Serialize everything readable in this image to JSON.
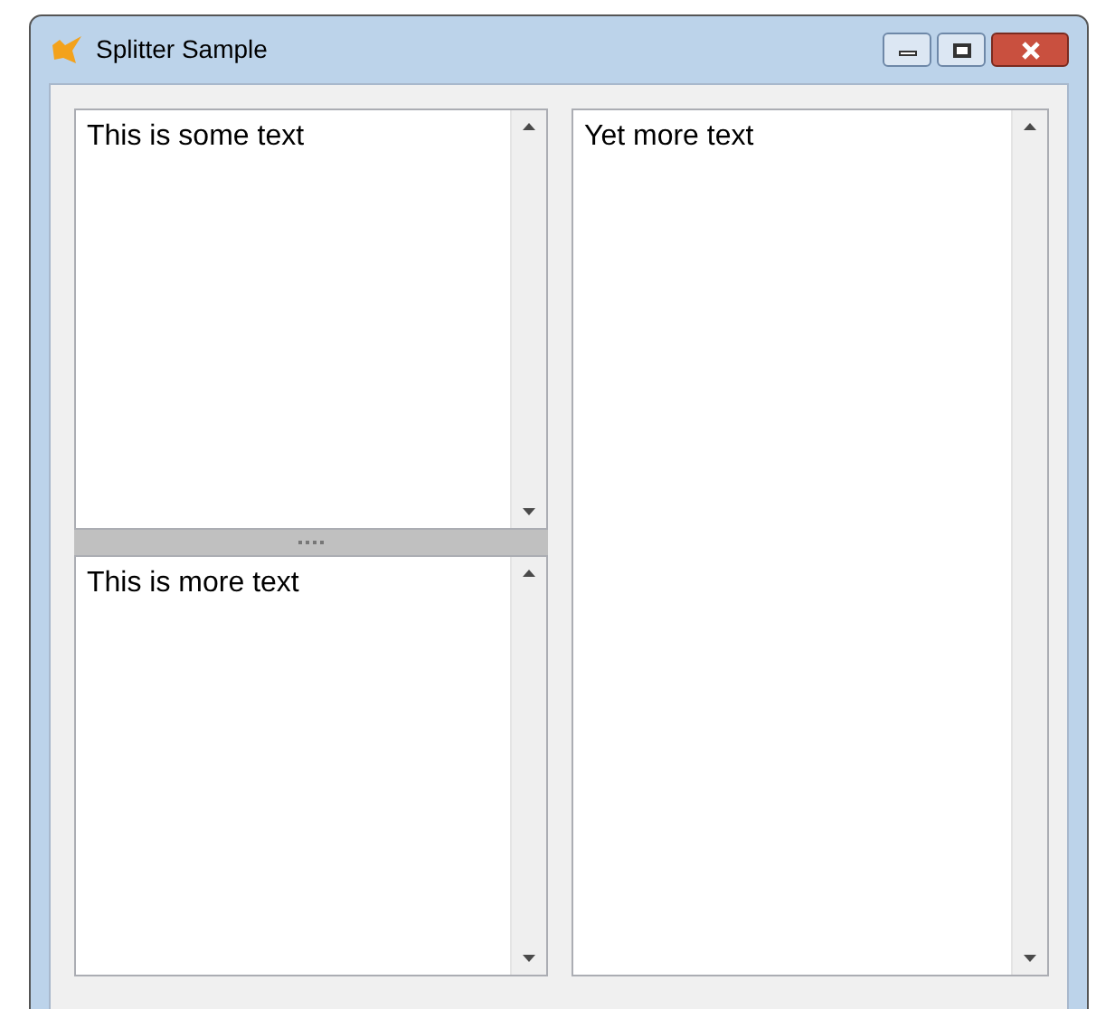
{
  "window": {
    "title": "Splitter Sample"
  },
  "left_panes": [
    {
      "text": "This is some text"
    },
    {
      "text": "This is more text"
    }
  ],
  "right_pane": {
    "text": "Yet more text"
  }
}
